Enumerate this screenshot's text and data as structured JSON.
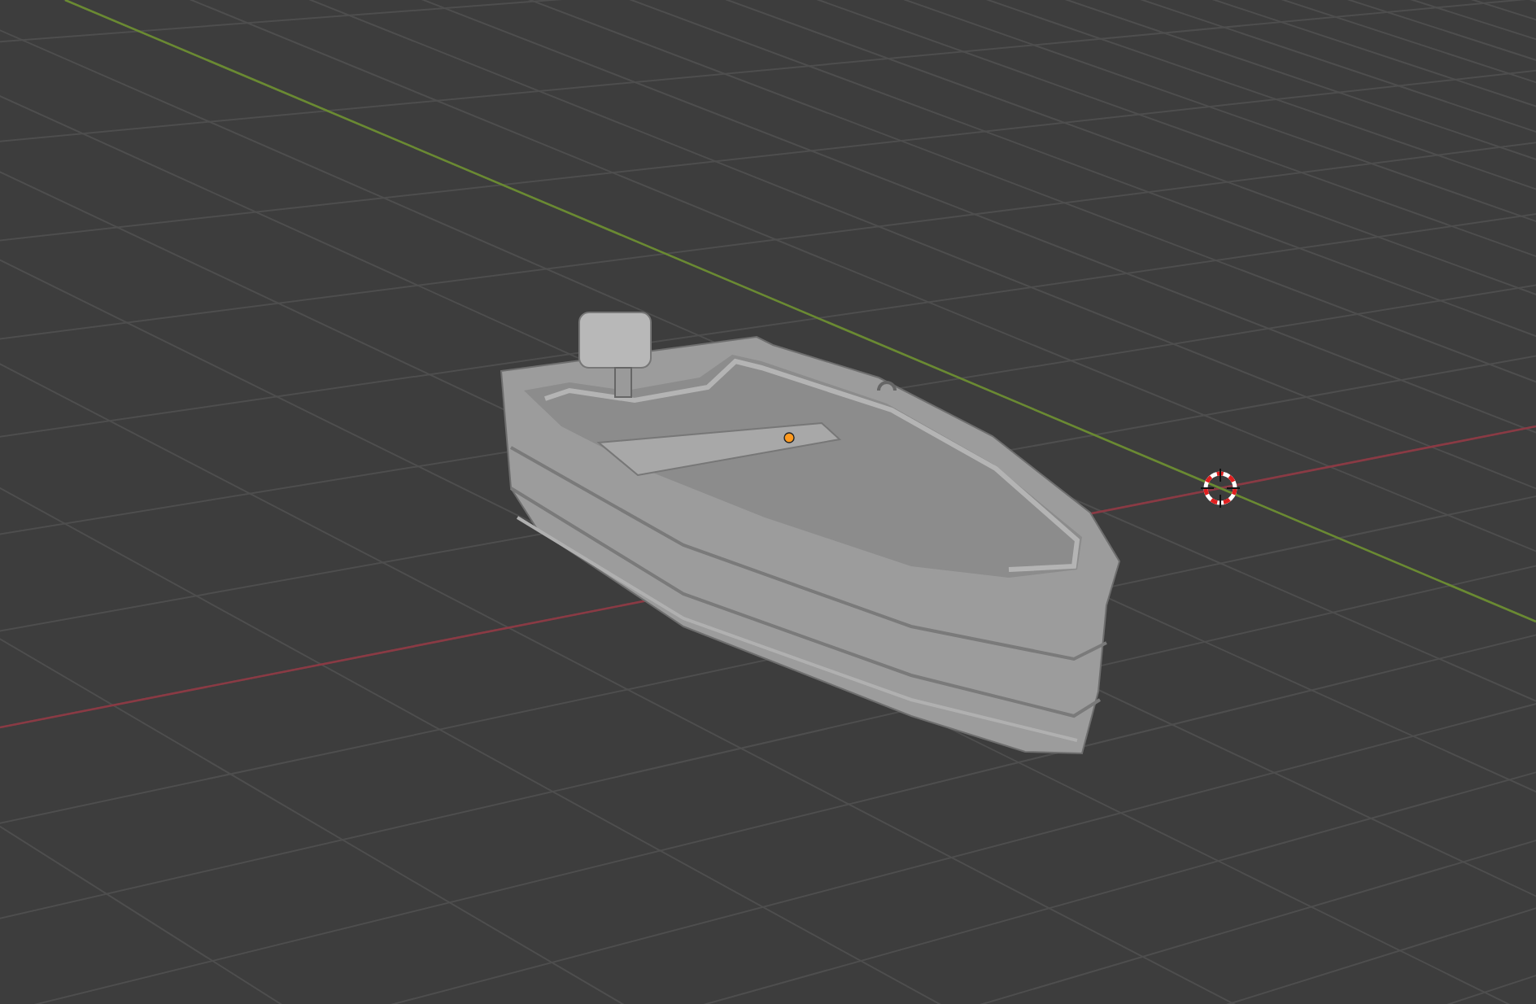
{
  "viewport": {
    "show_grid": true,
    "show_cursor": true,
    "show_origin": true
  }
}
